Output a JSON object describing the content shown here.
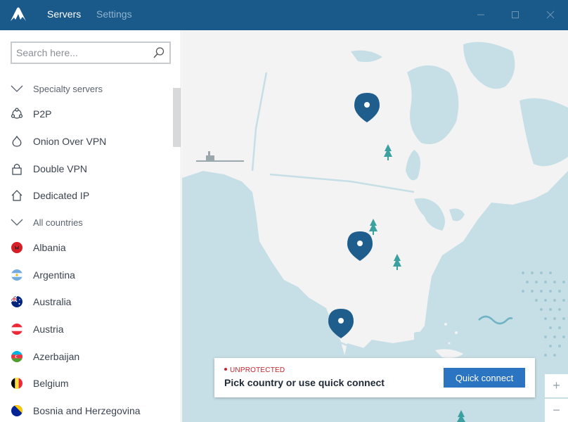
{
  "app": {
    "tabs": [
      {
        "label": "Servers",
        "active": true
      },
      {
        "label": "Settings",
        "active": false
      }
    ],
    "window_controls": [
      "minimize-icon",
      "maximize-icon",
      "close-icon"
    ]
  },
  "sidebar": {
    "search": {
      "placeholder": "Search here...",
      "value": ""
    },
    "items": [
      {
        "label": "Specialty servers",
        "type": "section",
        "icon": "chevron-down-icon"
      },
      {
        "label": "P2P",
        "type": "item",
        "icon": "p2p-icon"
      },
      {
        "label": "Onion Over VPN",
        "type": "item",
        "icon": "onion-icon"
      },
      {
        "label": "Double VPN",
        "type": "item",
        "icon": "lock-icon"
      },
      {
        "label": "Dedicated IP",
        "type": "item",
        "icon": "home-icon"
      },
      {
        "label": "All countries",
        "type": "section",
        "icon": "chevron-down-icon"
      },
      {
        "label": "Albania",
        "type": "country",
        "icon": "albania-flag-icon"
      },
      {
        "label": "Argentina",
        "type": "country",
        "icon": "argentina-flag-icon"
      },
      {
        "label": "Australia",
        "type": "country",
        "icon": "australia-flag-icon"
      },
      {
        "label": "Austria",
        "type": "country",
        "icon": "austria-flag-icon"
      },
      {
        "label": "Azerbaijan",
        "type": "country",
        "icon": "azerbaijan-flag-icon"
      },
      {
        "label": "Belgium",
        "type": "country",
        "icon": "belgium-flag-icon"
      },
      {
        "label": "Bosnia and Herzegovina",
        "type": "country",
        "icon": "bosnia-flag-icon"
      }
    ]
  },
  "status": {
    "label": "UNPROTECTED",
    "message": "Pick country or use quick connect",
    "button": "Quick connect",
    "color": "#c8232c"
  },
  "zoom": {
    "in": "+",
    "out": "−"
  },
  "colors": {
    "titlebar": "#1a5a8a",
    "accent": "#2b74c2",
    "map_water": "#c6dfe6",
    "map_land": "#f3f3f3",
    "pin": "#1f5e8c"
  }
}
